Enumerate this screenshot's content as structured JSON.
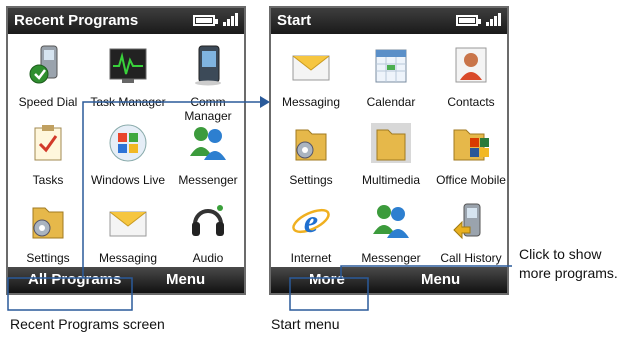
{
  "left_phone": {
    "title": "Recent Programs",
    "tiles": [
      {
        "label": "Speed Dial",
        "icon": "speed-dial-icon"
      },
      {
        "label": "Task Manager",
        "icon": "task-manager-icon"
      },
      {
        "label": "Comm Manager",
        "icon": "comm-manager-icon"
      },
      {
        "label": "Tasks",
        "icon": "tasks-icon"
      },
      {
        "label": "Windows Live",
        "icon": "windows-live-icon"
      },
      {
        "label": "Messenger",
        "icon": "messenger-icon"
      },
      {
        "label": "Settings",
        "icon": "settings-icon"
      },
      {
        "label": "Messaging",
        "icon": "messaging-icon"
      },
      {
        "label": "Audio Manager",
        "icon": "audio-manager-icon"
      }
    ],
    "softkey_left": "All Programs",
    "softkey_right": "Menu",
    "caption": "Recent Programs screen"
  },
  "right_phone": {
    "title": "Start",
    "tiles": [
      {
        "label": "Messaging",
        "icon": "messaging-icon"
      },
      {
        "label": "Calendar",
        "icon": "calendar-icon"
      },
      {
        "label": "Contacts",
        "icon": "contacts-icon"
      },
      {
        "label": "Settings",
        "icon": "settings-icon"
      },
      {
        "label": "Multimedia",
        "icon": "multimedia-icon"
      },
      {
        "label": "Office Mobile",
        "icon": "office-mobile-icon"
      },
      {
        "label": "Internet Explorer",
        "icon": "internet-explorer-icon"
      },
      {
        "label": "Messenger",
        "icon": "messenger-icon"
      },
      {
        "label": "Call History",
        "icon": "call-history-icon"
      }
    ],
    "softkey_left": "More",
    "softkey_right": "Menu",
    "caption": "Start menu"
  },
  "callout": {
    "line1": "Click to show",
    "line2": "more programs."
  },
  "colors": {
    "bar": "#1a1a1a",
    "highlight_box": "#2a5a9a",
    "arrow": "#2a5a9a"
  }
}
